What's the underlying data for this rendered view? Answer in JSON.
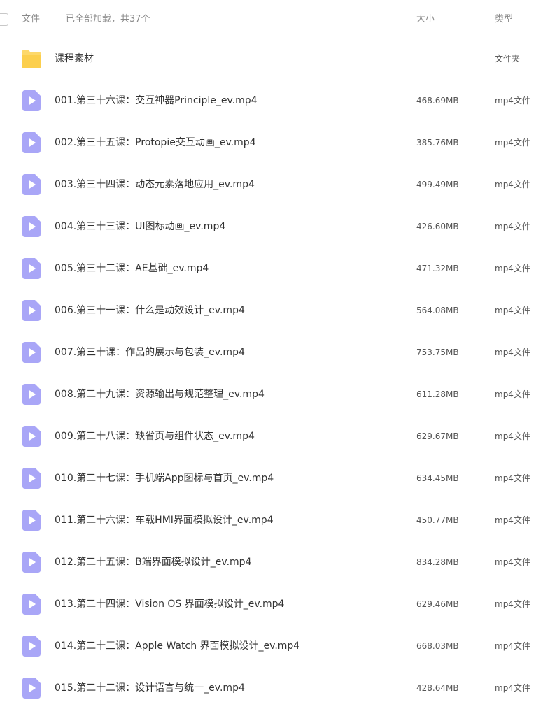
{
  "header": {
    "col_file": "文件",
    "status": "已全部加载，共37个",
    "col_size": "大小",
    "col_type": "类型"
  },
  "folder": {
    "name": "课程素材",
    "size": "-",
    "type": "文件夹"
  },
  "files": [
    {
      "name": "001.第三十六课：交互神器Principle_ev.mp4",
      "size": "468.69MB",
      "type": "mp4文件"
    },
    {
      "name": "002.第三十五课：Protopie交互动画_ev.mp4",
      "size": "385.76MB",
      "type": "mp4文件"
    },
    {
      "name": "003.第三十四课：动态元素落地应用_ev.mp4",
      "size": "499.49MB",
      "type": "mp4文件"
    },
    {
      "name": "004.第三十三课：UI图标动画_ev.mp4",
      "size": "426.60MB",
      "type": "mp4文件"
    },
    {
      "name": "005.第三十二课：AE基础_ev.mp4",
      "size": "471.32MB",
      "type": "mp4文件"
    },
    {
      "name": "006.第三十一课：什么是动效设计_ev.mp4",
      "size": "564.08MB",
      "type": "mp4文件"
    },
    {
      "name": "007.第三十课：作品的展示与包装_ev.mp4",
      "size": "753.75MB",
      "type": "mp4文件"
    },
    {
      "name": "008.第二十九课：资源输出与规范整理_ev.mp4",
      "size": "611.28MB",
      "type": "mp4文件"
    },
    {
      "name": "009.第二十八课：缺省页与组件状态_ev.mp4",
      "size": "629.67MB",
      "type": "mp4文件"
    },
    {
      "name": "010.第二十七课：手机端App图标与首页_ev.mp4",
      "size": "634.45MB",
      "type": "mp4文件"
    },
    {
      "name": "011.第二十六课：车载HMI界面模拟设计_ev.mp4",
      "size": "450.77MB",
      "type": "mp4文件"
    },
    {
      "name": "012.第二十五课：B端界面模拟设计_ev.mp4",
      "size": "834.28MB",
      "type": "mp4文件"
    },
    {
      "name": "013.第二十四课：Vision OS 界面模拟设计_ev.mp4",
      "size": "629.46MB",
      "type": "mp4文件"
    },
    {
      "name": "014.第二十三课：Apple Watch 界面模拟设计_ev.mp4",
      "size": "668.03MB",
      "type": "mp4文件"
    },
    {
      "name": "015.第二十二课：设计语言与统一_ev.mp4",
      "size": "428.64MB",
      "type": "mp4文件"
    }
  ],
  "colors": {
    "video_icon": "#a9a6f7",
    "folder_icon": "#fdd86a"
  }
}
